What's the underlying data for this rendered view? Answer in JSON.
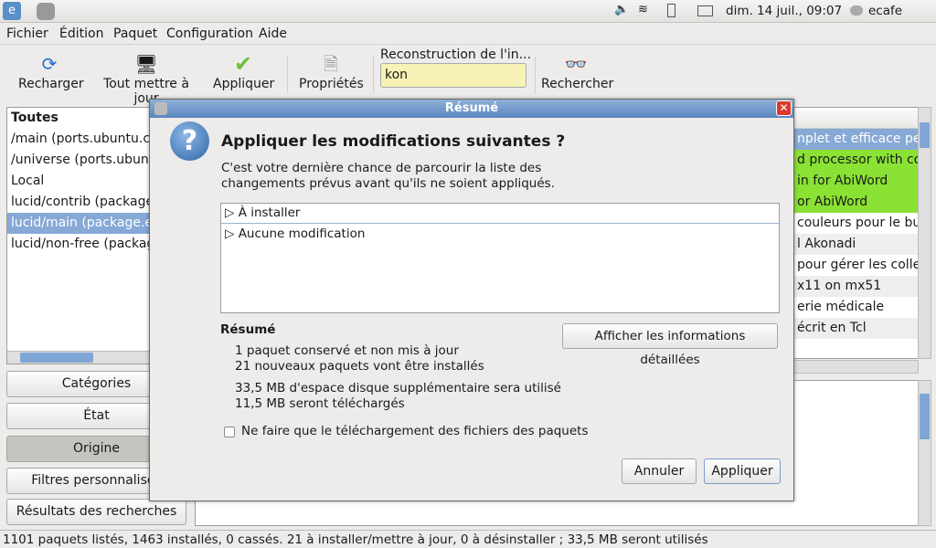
{
  "panel": {
    "clock": "dim. 14 juil., 09:07",
    "user": "ecafe"
  },
  "menu": [
    "Fichier",
    "Édition",
    "Paquet",
    "Configuration",
    "Aide"
  ],
  "toolbar": {
    "reload": "Recharger",
    "upgrade_all": "Tout mettre à jour",
    "apply": "Appliquer",
    "properties": "Propriétés",
    "search_label": "Reconstruction de l'in...",
    "search_value": "kon",
    "search": "Rechercher"
  },
  "origins": [
    "Toutes",
    "/main (ports.ubuntu.com)",
    "/universe (ports.ubuntu.com)",
    "Local",
    "lucid/contrib (package.ecafe)",
    "lucid/main (package.ecafe)",
    "lucid/non-free (package.ecafe)"
  ],
  "filters": [
    "Catégories",
    "État",
    "Origine",
    "Filtres personnalisés",
    "Résultats des recherches"
  ],
  "packages": [
    "nplet et efficace pen",
    "d processor with col",
    "in for AbiWord",
    "or AbiWord",
    " couleurs pour le bu",
    "l  Akonadi",
    " pour gérer les colle",
    "x11 on mx51",
    "erie médicale",
    "écrit en Tcl"
  ],
  "status": "1101 paquets listés, 1463 installés, 0 cassés. 21 à installer/mettre à jour, 0 à désinstaller ; 33,5 MB seront utilisés",
  "dialog": {
    "title": "Résumé",
    "heading": "Appliquer les modifications suivantes ?",
    "text1": "C'est votre dernière chance de parcourir la liste des",
    "text2": "changements prévus avant qu'ils ne soient appliqués.",
    "tree": [
      "À installer",
      "Aucune modification"
    ],
    "summary_heading": "Résumé",
    "details_button": "Afficher les informations détaillées",
    "lines": [
      "1 paquet conservé et non mis à jour",
      "21 nouveaux paquets vont être installés",
      "33,5 MB d'espace disque supplémentaire sera utilisé",
      "11,5 MB seront téléchargés"
    ],
    "checkbox": "Ne faire que le téléchargement des fichiers des paquets",
    "cancel": "Annuler",
    "apply": "Appliquer"
  }
}
